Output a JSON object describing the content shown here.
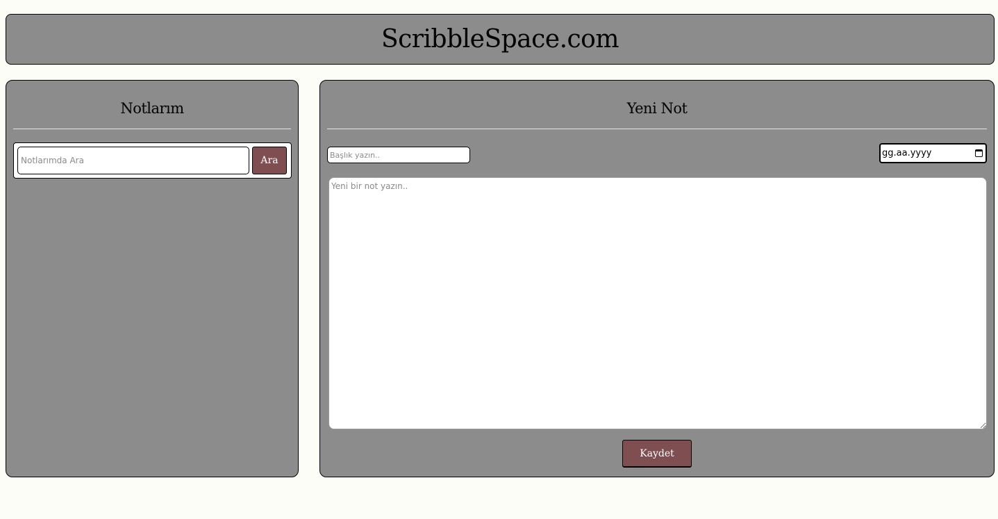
{
  "header": {
    "site_title": "ScribbleSpace.com"
  },
  "notes_panel": {
    "heading": "Notlarım",
    "search": {
      "placeholder": "Notlarımda Ara",
      "button_label": "Ara"
    }
  },
  "new_note_panel": {
    "heading": "Yeni Not",
    "title_placeholder": "Başlık yazın..",
    "date_placeholder": "gg.aa.yyyy",
    "body_placeholder": "Yeni bir not yazın..",
    "save_label": "Kaydet"
  },
  "colors": {
    "background": "#fdfdf8",
    "panel": "#8c8c8c",
    "button": "#7e4e50"
  },
  "icons": {
    "date_picker": "calendar-icon"
  }
}
